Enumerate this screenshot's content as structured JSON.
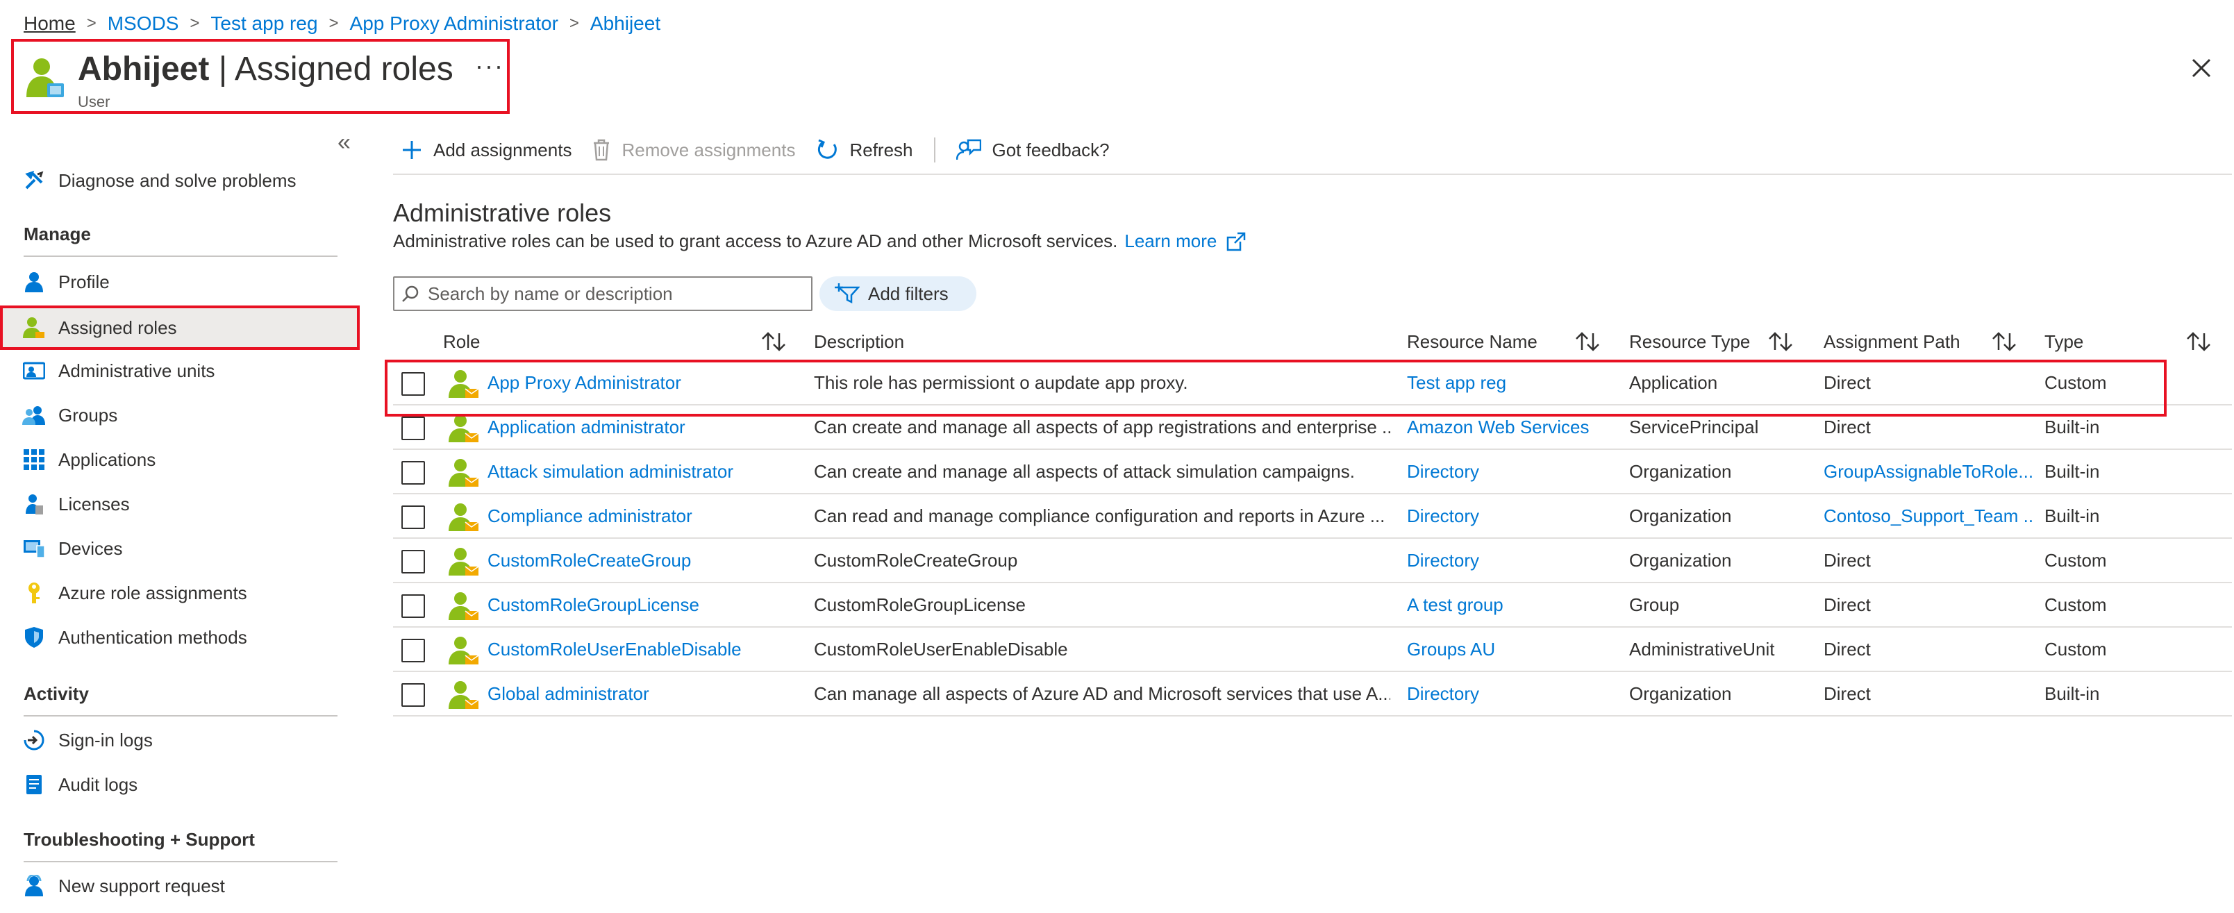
{
  "breadcrumb": [
    "Home",
    "MSODS",
    "Test app reg",
    "App Proxy Administrator",
    "Abhijeet"
  ],
  "header": {
    "name": "Abhijeet",
    "title_rest": " | Assigned roles",
    "subtitle": "User",
    "more": "···"
  },
  "sidebar": {
    "items_top": [
      {
        "label": "Diagnose and solve problems",
        "icon": "wrench-icon"
      }
    ],
    "sections": [
      {
        "heading": "Manage",
        "items": [
          {
            "label": "Profile",
            "icon": "user-icon"
          },
          {
            "label": "Assigned roles",
            "icon": "role-icon",
            "active": true
          },
          {
            "label": "Administrative units",
            "icon": "admin-units-icon"
          },
          {
            "label": "Groups",
            "icon": "groups-icon"
          },
          {
            "label": "Applications",
            "icon": "apps-grid-icon"
          },
          {
            "label": "Licenses",
            "icon": "license-icon"
          },
          {
            "label": "Devices",
            "icon": "device-icon"
          },
          {
            "label": "Azure role assignments",
            "icon": "key-icon"
          },
          {
            "label": "Authentication methods",
            "icon": "shield-icon"
          }
        ]
      },
      {
        "heading": "Activity",
        "items": [
          {
            "label": "Sign-in logs",
            "icon": "signin-icon"
          },
          {
            "label": "Audit logs",
            "icon": "audit-icon"
          }
        ]
      },
      {
        "heading": "Troubleshooting + Support",
        "items": [
          {
            "label": "New support request",
            "icon": "support-icon"
          }
        ]
      }
    ]
  },
  "toolbar": {
    "add": "Add assignments",
    "remove": "Remove assignments",
    "refresh": "Refresh",
    "feedback": "Got feedback?"
  },
  "main": {
    "heading": "Administrative roles",
    "description": "Administrative roles can be used to grant access to Azure AD and other Microsoft services.",
    "learn_more": "Learn more",
    "search_placeholder": "Search by name or description",
    "add_filters": "Add filters"
  },
  "table": {
    "columns": [
      "Role",
      "Description",
      "Resource Name",
      "Resource Type",
      "Assignment Path",
      "Type"
    ],
    "rows": [
      {
        "role": "App Proxy Administrator",
        "description": "This role has permissiont o aupdate app proxy.",
        "resource_name": "Test app reg",
        "resource_type": "Application",
        "path": "Direct",
        "path_link": false,
        "type": "Custom"
      },
      {
        "role": "Application administrator",
        "description": "Can create and manage all aspects of app registrations and enterprise ...",
        "resource_name": "Amazon Web Services",
        "resource_type": "ServicePrincipal",
        "path": "Direct",
        "path_link": false,
        "type": "Built-in"
      },
      {
        "role": "Attack simulation administrator",
        "description": "Can create and manage all aspects of attack simulation campaigns.",
        "resource_name": "Directory",
        "resource_type": "Organization",
        "path": "GroupAssignableToRole...",
        "path_link": true,
        "type": "Built-in"
      },
      {
        "role": "Compliance administrator",
        "description": "Can read and manage compliance configuration and reports in Azure ...",
        "resource_name": "Directory",
        "resource_type": "Organization",
        "path": "Contoso_Support_Team ...",
        "path_link": true,
        "type": "Built-in"
      },
      {
        "role": "CustomRoleCreateGroup",
        "description": "CustomRoleCreateGroup",
        "resource_name": "Directory",
        "resource_type": "Organization",
        "path": "Direct",
        "path_link": false,
        "type": "Custom"
      },
      {
        "role": "CustomRoleGroupLicense",
        "description": "CustomRoleGroupLicense",
        "resource_name": "A test group",
        "resource_type": "Group",
        "path": "Direct",
        "path_link": false,
        "type": "Custom"
      },
      {
        "role": "CustomRoleUserEnableDisable",
        "description": "CustomRoleUserEnableDisable",
        "resource_name": "Groups AU",
        "resource_type": "AdministrativeUnit",
        "path": "Direct",
        "path_link": false,
        "type": "Custom"
      },
      {
        "role": "Global administrator",
        "description": "Can manage all aspects of Azure AD and Microsoft services that use A...",
        "resource_name": "Directory",
        "resource_type": "Organization",
        "path": "Direct",
        "path_link": false,
        "type": "Built-in"
      }
    ]
  },
  "colors": {
    "link": "#0078d4",
    "highlight": "#e81123",
    "user_green": "#8cbd18"
  }
}
